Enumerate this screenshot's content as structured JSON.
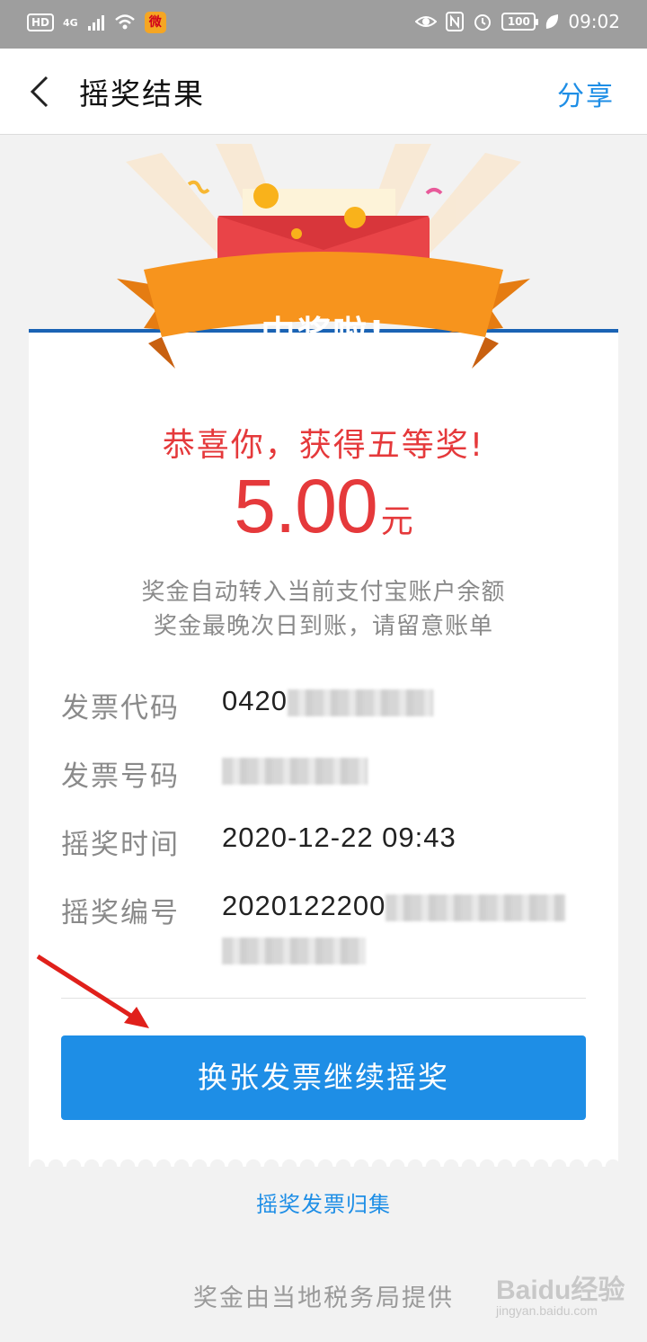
{
  "status_bar": {
    "hd": "HD",
    "network": "4G",
    "battery": "100",
    "time": "09:02"
  },
  "nav": {
    "title": "摇奖结果",
    "share": "分享"
  },
  "banner": {
    "text": "中奖啦!"
  },
  "result": {
    "congrats": "恭喜你，获得五等奖!",
    "amount": "5.00",
    "unit": "元",
    "note_line1": "奖金自动转入当前支付宝账户余额",
    "note_line2": "奖金最晚次日到账，请留意账单"
  },
  "details": {
    "invoice_code_label": "发票代码",
    "invoice_code_value": "0420",
    "invoice_number_label": "发票号码",
    "draw_time_label": "摇奖时间",
    "draw_time_value": "2020-12-22 09:43",
    "draw_number_label": "摇奖编号",
    "draw_number_value": "2020122200"
  },
  "actions": {
    "continue_button": "换张发票继续摇奖",
    "collection_link": "摇奖发票归集"
  },
  "footer": {
    "text": "奖金由当地税务局提供"
  },
  "watermark": {
    "main": "Baidu经验",
    "sub": "jingyan.baidu.com"
  },
  "colors": {
    "accent_blue": "#1e8ee6",
    "prize_red": "#e5393b",
    "banner_orange": "#f7941d",
    "card_top_border": "#1a63b4"
  },
  "icons": [
    "back-chevron-icon",
    "eye-icon",
    "nfc-icon",
    "alarm-icon",
    "leaf-icon",
    "wifi-icon",
    "signal-icon",
    "weibo-icon"
  ]
}
